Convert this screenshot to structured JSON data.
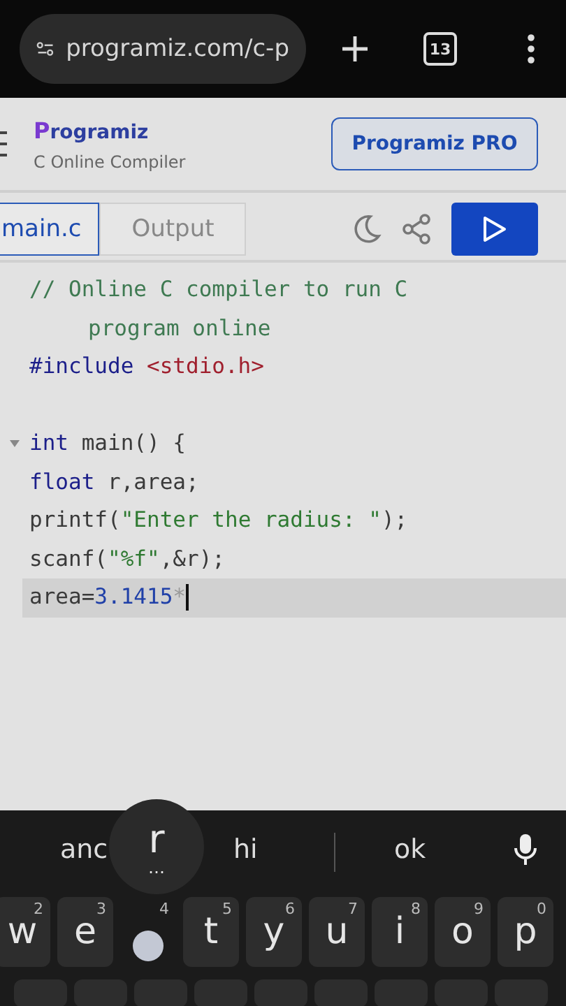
{
  "browser": {
    "url": "programiz.com/c-p",
    "tab_count": "13"
  },
  "header": {
    "logo": "Programiz",
    "subtitle": "C Online Compiler",
    "pro_button": "Programiz PRO"
  },
  "tabs": [
    {
      "label": "main.c",
      "selected": true
    },
    {
      "label": "Output",
      "selected": false
    }
  ],
  "code": [
    {
      "fold": false,
      "current": false,
      "tokens": [
        {
          "kind": "comment",
          "text": "// Online C compiler to run C program online"
        }
      ]
    },
    {
      "fold": false,
      "current": false,
      "tokens": [
        {
          "kind": "keyword",
          "text": "#include"
        },
        {
          "kind": "path",
          "text": " <stdio.h>"
        }
      ]
    },
    {
      "fold": false,
      "current": false
    },
    {
      "fold": true,
      "current": false,
      "tokens": [
        {
          "kind": "keyword",
          "text": "int"
        },
        {
          "kind": "plain",
          "text": " main() {"
        }
      ]
    },
    {
      "fold": false,
      "current": false,
      "tokens": [
        {
          "kind": "keyword",
          "text": "float"
        },
        {
          "kind": "plain",
          "text": " r,area;"
        }
      ]
    },
    {
      "fold": false,
      "current": false,
      "tokens": [
        {
          "kind": "plain",
          "text": "printf("
        },
        {
          "kind": "string",
          "text": "\"Enter the radius: \""
        },
        {
          "kind": "plain",
          "text": ");"
        }
      ]
    },
    {
      "fold": false,
      "current": false,
      "tokens": [
        {
          "kind": "plain",
          "text": "scanf("
        },
        {
          "kind": "string",
          "text": "\"%f\""
        },
        {
          "kind": "plain",
          "text": ",&r);"
        }
      ]
    },
    {
      "fold": false,
      "current": true,
      "tokens": [
        {
          "kind": "plain",
          "text": "area="
        },
        {
          "kind": "number",
          "text": "3.1415"
        },
        {
          "kind": "operator",
          "text": "*"
        }
      ]
    }
  ],
  "keyboard": {
    "suggestions": [
      "anc",
      "hi",
      "ok"
    ],
    "popup": {
      "letter": "r",
      "more": "…"
    },
    "keys": [
      {
        "letter": "w",
        "hint": "2",
        "pressed": false
      },
      {
        "letter": "e",
        "hint": "3",
        "pressed": false
      },
      {
        "hint": "4",
        "pressed": true
      },
      {
        "letter": "t",
        "hint": "5",
        "pressed": false
      },
      {
        "letter": "y",
        "hint": "6",
        "pressed": false
      },
      {
        "letter": "u",
        "hint": "7",
        "pressed": false
      },
      {
        "letter": "i",
        "hint": "8",
        "pressed": false
      },
      {
        "letter": "o",
        "hint": "9",
        "pressed": false
      },
      {
        "letter": "p",
        "hint": "0",
        "pressed": false
      }
    ]
  }
}
